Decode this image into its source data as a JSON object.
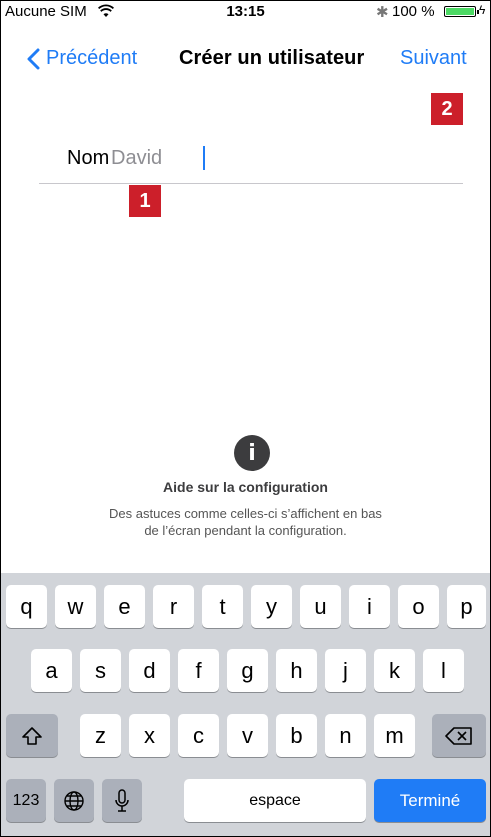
{
  "status_bar": {
    "carrier": "Aucune SIM",
    "time": "13:15",
    "battery": "100 %",
    "battery_level": 1.0,
    "charging": true,
    "icons": [
      "wifi-icon",
      "bluetooth-icon",
      "battery-icon",
      "charging-bolt-icon"
    ]
  },
  "nav": {
    "back_label": "Précédent",
    "title": "Créer un utilisateur",
    "next_label": "Suivant"
  },
  "form": {
    "name_label": "Nom",
    "name_value": "David"
  },
  "help": {
    "icon": "info-icon",
    "title": "Aide sur la configuration",
    "text_line1": "Des astuces comme celles-ci s’affichent en bas",
    "text_line2": "de l’écran pendant la configuration."
  },
  "annotations": {
    "badge1": "1",
    "badge2": "2"
  },
  "keyboard": {
    "row1": [
      "q",
      "w",
      "e",
      "r",
      "t",
      "y",
      "u",
      "i",
      "o",
      "p"
    ],
    "row2": [
      "a",
      "s",
      "d",
      "f",
      "g",
      "h",
      "j",
      "k",
      "l"
    ],
    "row3": [
      "z",
      "x",
      "c",
      "v",
      "b",
      "n",
      "m"
    ],
    "numbers_label": "123",
    "space_label": "espace",
    "done_label": "Terminé"
  },
  "colors": {
    "accent": "#1f7cf6",
    "badge": "#cc1f2a",
    "keyboard_bg": "#d1d4d9"
  }
}
